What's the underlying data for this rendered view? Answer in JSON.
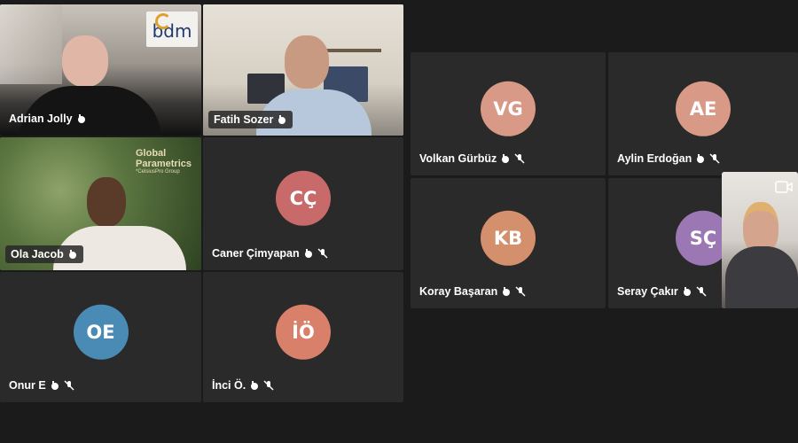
{
  "participants": [
    {
      "name": "Adrian Jolly",
      "kind": "video"
    },
    {
      "name": "Fatih Sozer",
      "kind": "video"
    },
    {
      "name": "Ola Jacob",
      "kind": "video",
      "overlay": {
        "title": "Global Parametrics",
        "subtitle": "*CelsiusPro Group"
      }
    },
    {
      "name": "Caner Çimyapan",
      "initials": "CÇ",
      "color": "#c96a6a"
    },
    {
      "name": "Onur E",
      "initials": "OE",
      "color": "#4a8bb5"
    },
    {
      "name": "İnci Ö.",
      "initials": "İÖ",
      "color": "#d9806a"
    },
    {
      "name": "Volkan Gürbüz",
      "initials": "VG",
      "color": "#d89a86"
    },
    {
      "name": "Aylin Erdoğan",
      "initials": "AE",
      "color": "#d89a86"
    },
    {
      "name": "Koray Başaran",
      "initials": "KB",
      "color": "#d4906c"
    },
    {
      "name": "Seray Çakır",
      "initials": "SÇ",
      "color": "#9b78b4"
    }
  ],
  "logo_text": "bdm",
  "colors": {
    "background": "#1b1b1b",
    "tile": "#2a2a2a"
  }
}
